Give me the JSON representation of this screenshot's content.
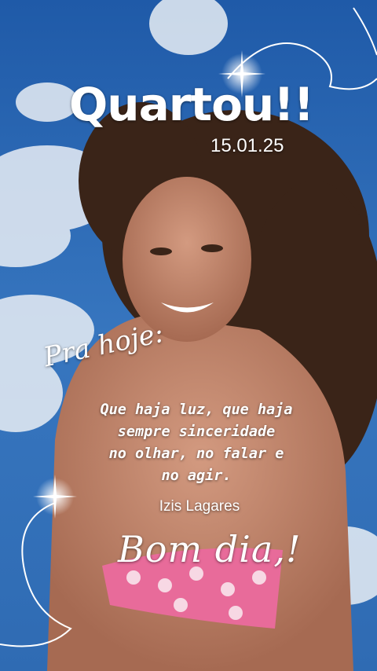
{
  "title": "Quartou!!",
  "date": "15.01.25",
  "intro": "Pra hoje:",
  "quote_lines": [
    "Que haja luz, que haja",
    "sempre sinceridade",
    "no olhar, no falar e",
    "no agir."
  ],
  "author": "Izis Lagares",
  "greeting": "Bom dia,!",
  "colors": {
    "sky": "#2b67ad",
    "text": "#ffffff"
  }
}
